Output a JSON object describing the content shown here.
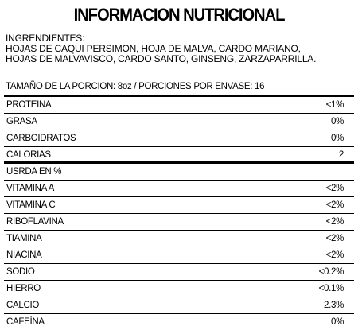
{
  "title": "INFORMACION NUTRICIONAL",
  "ingredients": {
    "label": "INGRENDIENTES:",
    "line1": "HOJAS DE CAQUI PERSIMON, HOJA DE MALVA, CARDO MARIANO,",
    "line2": "HOJAS DE MALVAVISCO, CARDO SANTO, GINSENG, ZARZAPARRILLA."
  },
  "serving": "TAMAÑO DE LA PORCION: 8oz / PORCIONES POR ENVASE: 16",
  "rows_top": [
    {
      "name": "PROTEINA",
      "value": "<1%"
    },
    {
      "name": "GRASA",
      "value": "0%"
    },
    {
      "name": "CARBOIDRATOS",
      "value": "0%"
    },
    {
      "name": "CALORIAS",
      "value": "2"
    }
  ],
  "rows_bottom": [
    {
      "name": "USRDA EN %",
      "value": ""
    },
    {
      "name": "VITAMINA A",
      "value": "<2%"
    },
    {
      "name": "VITAMINA C",
      "value": "<2%"
    },
    {
      "name": "RIBOFLAVINA",
      "value": "<2%"
    },
    {
      "name": "TIAMINA",
      "value": "<2%"
    },
    {
      "name": "NIACINA",
      "value": "<2%"
    },
    {
      "name": "SODIO",
      "value": "<0.2%"
    },
    {
      "name": "HIERRO",
      "value": "<0.1%"
    },
    {
      "name": "CALCIO",
      "value": "2.3%"
    },
    {
      "name": "CAFEÍNA",
      "value": "0%"
    }
  ]
}
